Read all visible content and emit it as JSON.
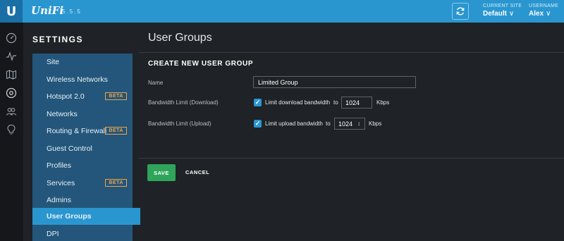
{
  "topbar": {
    "logo": "U",
    "brand": "UniFi",
    "version": "5.5.5",
    "refresh_icon": "refresh-icon",
    "site_label": "CURRENT SITE",
    "site_value": "Default",
    "user_label": "USERNAME",
    "user_value": "Alex"
  },
  "rail": {
    "icons": [
      "dashboard-icon",
      "statistics-icon",
      "map-icon",
      "devices-icon",
      "clients-icon",
      "insights-icon"
    ]
  },
  "sidebar": {
    "title": "SETTINGS",
    "items": [
      {
        "label": "Site"
      },
      {
        "label": "Wireless Networks"
      },
      {
        "label": "Hotspot 2.0",
        "badge": "BETA"
      },
      {
        "label": "Networks"
      },
      {
        "label": "Routing & Firewall",
        "badge": "BETA"
      },
      {
        "label": "Guest Control"
      },
      {
        "label": "Profiles"
      },
      {
        "label": "Services",
        "badge": "BETA"
      },
      {
        "label": "Admins"
      },
      {
        "label": "User Groups",
        "active": true
      },
      {
        "label": "DPI"
      }
    ]
  },
  "main": {
    "page_title": "User Groups",
    "section_title": "CREATE NEW USER GROUP",
    "name_label": "Name",
    "name_value": "Limited Group",
    "download_label": "Bandwidth Limit (Download)",
    "download_check_label": "Limit download bandwidth",
    "download_to": "to",
    "download_value": "1024",
    "download_unit": "Kbps",
    "upload_label": "Bandwidth Limit (Upload)",
    "upload_check_label": "Limit upload bandwidth",
    "upload_to": "to",
    "upload_value": "1024",
    "upload_unit": "Kbps",
    "save_label": "SAVE",
    "cancel_label": "CANCEL"
  },
  "colors": {
    "accent": "#2a96d0",
    "menu_bg": "#23567a",
    "beta": "#f0a24a",
    "save": "#2fa45b"
  }
}
